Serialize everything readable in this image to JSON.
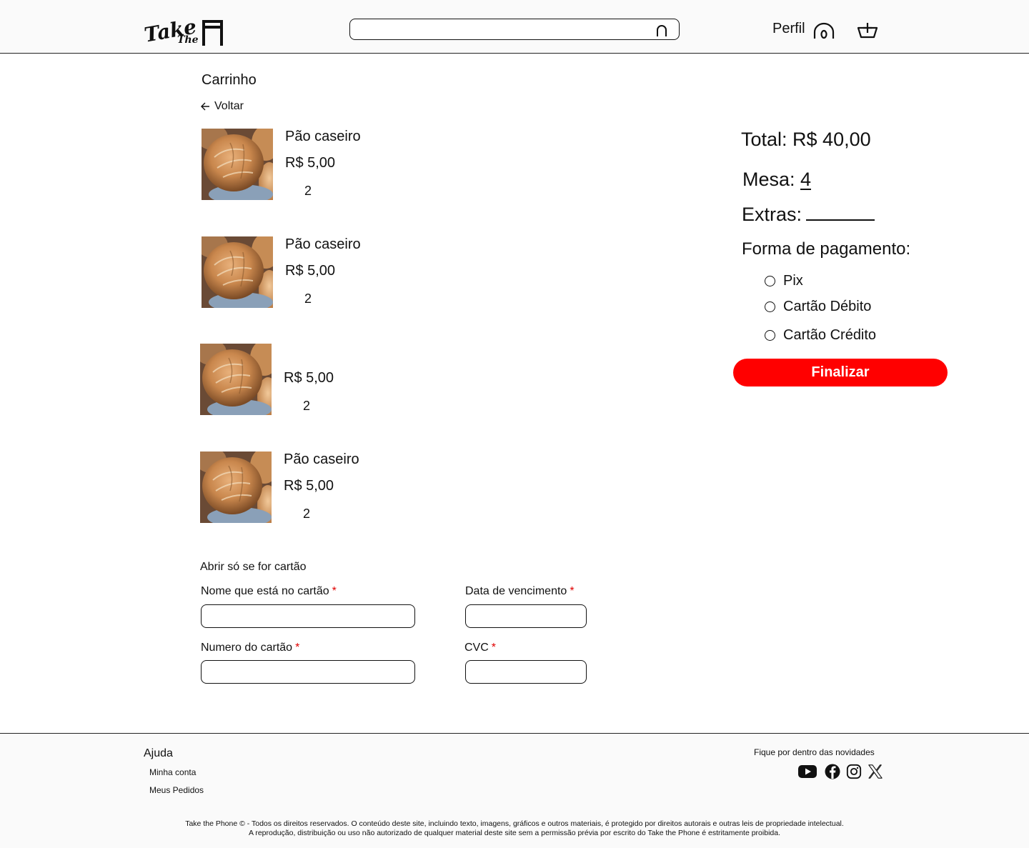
{
  "header": {
    "logo_word1": "Take",
    "logo_word2": "The",
    "search": {
      "placeholder": "",
      "value": ""
    },
    "profile_label": "Perfil"
  },
  "page": {
    "title": "Carrinho",
    "back_label": "Voltar"
  },
  "cart_items": [
    {
      "name": "Pão caseiro",
      "price": "R$ 5,00",
      "qty": "2"
    },
    {
      "name": "Pão caseiro",
      "price": "R$ 5,00",
      "qty": "2"
    },
    {
      "name": "",
      "price": "R$ 5,00",
      "qty": "2"
    },
    {
      "name": "Pão caseiro",
      "price": "R$ 5,00",
      "qty": "2"
    }
  ],
  "summary": {
    "total": "Total: R$ 40,00",
    "mesa_label": "Mesa:",
    "mesa_value": "4",
    "extras_label": "Extras:",
    "payment_title": "Forma de pagamento:",
    "payment_options": [
      "Pix",
      "Cartão Débito",
      "Cartão Crédito"
    ],
    "finalize_label": "Finalizar",
    "finalize_color": "#ff0000"
  },
  "card_form": {
    "note": "Abrir só se for cartão",
    "name_label": "Nome que está no cartão",
    "expiry_label": "Data de vencimento",
    "number_label": "Numero do cartão",
    "cvc_label": "CVC",
    "required_mark": "*"
  },
  "footer": {
    "help_title": "Ajuda",
    "links": [
      "Minha conta",
      "Meus Pedidos"
    ],
    "newsletter": "Fique por dentro das novidades",
    "social_icons": [
      "youtube-icon",
      "facebook-icon",
      "instagram-icon",
      "x-icon"
    ],
    "copyright_line1": "Take the Phone © - Todos os direitos reservados. O conteúdo deste site, incluindo texto, imagens, gráficos e outros materiais, é protegido por direitos autorais e outras leis de propriedade intelectual.",
    "copyright_line2": "A reprodução, distribuição ou uso não autorizado de qualquer material deste site sem a permissão prévia por escrito do Take the Phone é estritamente proibida."
  }
}
